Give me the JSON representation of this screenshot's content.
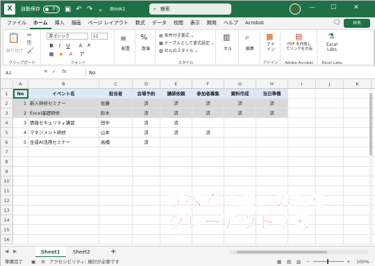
{
  "titlebar": {
    "autosave_label": "自動保存",
    "autosave_state": "オフ",
    "doc_title": "Book1",
    "search_placeholder": "検索"
  },
  "menu": {
    "tabs": [
      "ファイル",
      "ホーム",
      "挿入",
      "描画",
      "ページ レイアウト",
      "数式",
      "データ",
      "校閲",
      "表示",
      "開発",
      "ヘルプ",
      "Acrobat"
    ],
    "active": "ホーム",
    "share_label": "共有"
  },
  "ribbon": {
    "paste": "貼り付け",
    "clipboard_group": "クリップボード",
    "font_name": "游ゴシック",
    "font_size": "11",
    "font_group": "フォント",
    "align": "配置",
    "number": "数値",
    "cond_format": "条件付き書式",
    "table_format": "テーブルとして書式設定",
    "cell_style": "セルのスタイル",
    "style_group": "スタイル",
    "cells": "セル",
    "editing": "編集",
    "addins": "アド\nイン",
    "addins_group": "アドイン",
    "pdf_create": "PDF を作成し\nてリンクを共有",
    "acrobat_group": "Adobe Acrobat",
    "excel_labs": "Excel\nLabs",
    "labs_group": "Excel Labs"
  },
  "formula_bar": {
    "name_box": "A1",
    "fx": "fx",
    "value": "No"
  },
  "grid": {
    "columns": [
      "A",
      "B",
      "C",
      "D",
      "E",
      "F",
      "G",
      "H",
      "I",
      "J",
      "K",
      "L"
    ],
    "header_row": [
      "No",
      "イベント名",
      "担当者",
      "会場予約",
      "講師依頼",
      "参加者募集",
      "資料作成",
      "当日準備"
    ],
    "rows": [
      [
        "1",
        "新人研修セミナー",
        "佐藤",
        "済",
        "済",
        "済",
        "済",
        "済"
      ],
      [
        "2",
        "Excel基礎研修",
        "鈴木",
        "済",
        "済",
        "済",
        "済",
        "済"
      ],
      [
        "3",
        "情報セキュリティ講習",
        "田中",
        "済",
        "済",
        "",
        "",
        ""
      ],
      [
        "4",
        "マネジメント研修",
        "山本",
        "済",
        "済",
        "済",
        "",
        ""
      ],
      [
        "5",
        "生成AI活用セミナー",
        "高橋",
        "済",
        "",
        "",
        "",
        ""
      ]
    ],
    "gray_rows": [
      0,
      1
    ],
    "row_numbers": [
      "1",
      "2",
      "3",
      "4",
      "5",
      "6",
      "7",
      "8",
      "9",
      "10",
      "11",
      "12",
      "13",
      "14",
      "15",
      "16"
    ]
  },
  "overlay": {
    "line1": "すべて「済」の行を",
    "line2": "グレーアウトする"
  },
  "sheets": {
    "tabs": [
      "Sheet1",
      "Sheet2"
    ],
    "active": "Sheet1",
    "add": "+"
  },
  "status": {
    "ready": "準備完了",
    "accessibility": "アクセシビリティ: 検討が必要です",
    "zoom": "100%"
  },
  "colors": {
    "brand": "#1e7145",
    "header_fill": "#dce9f7",
    "gray_fill": "#d9d9d9",
    "overlay_text": "#e8231a"
  }
}
